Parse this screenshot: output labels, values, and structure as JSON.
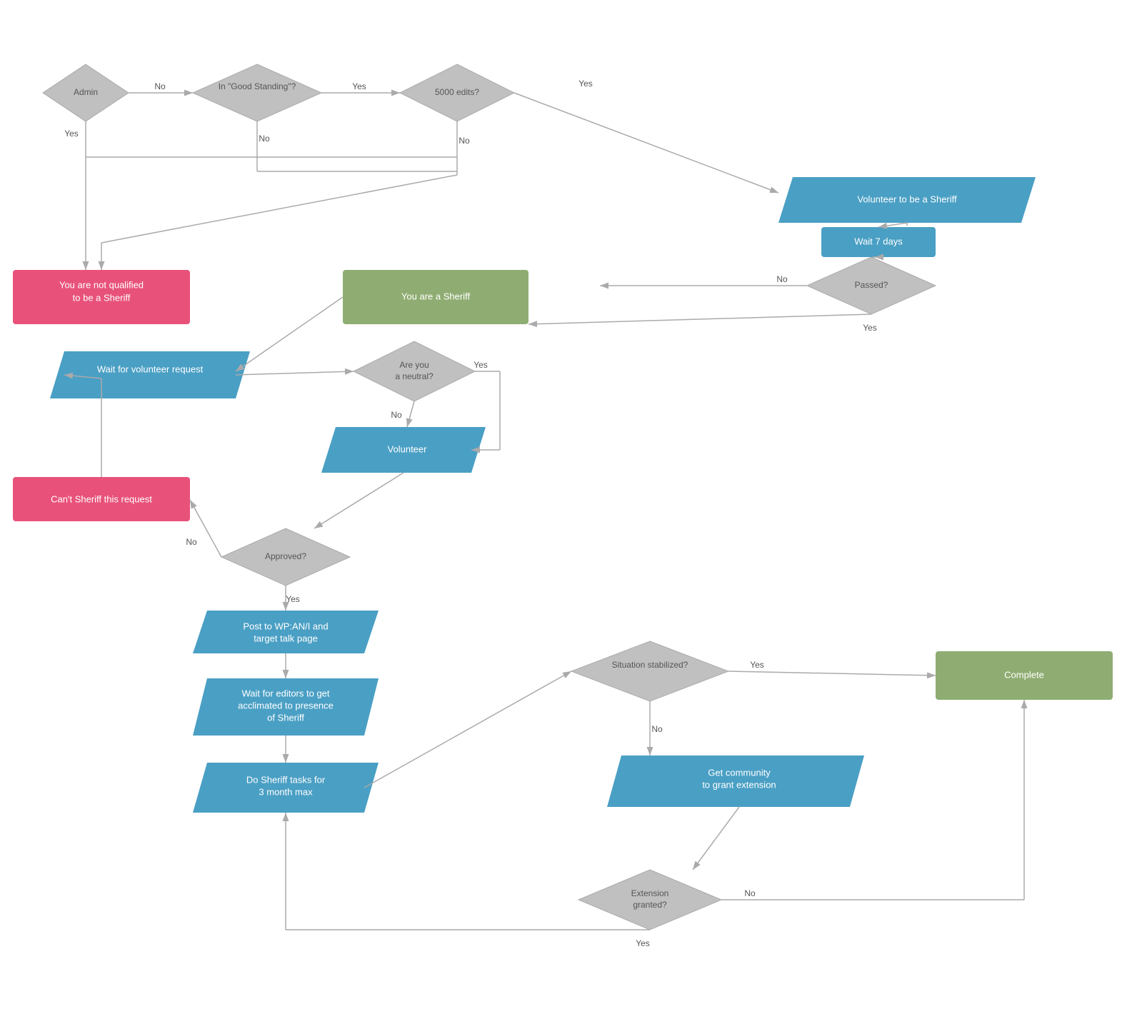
{
  "nodes": {
    "admin": "Admin",
    "good_standing": "In \"Good Standing\"?",
    "edits5000": "5000 edits?",
    "volunteer_sheriff": "Volunteer to be a Sheriff",
    "wait7": "Wait 7 days",
    "passed": "Passed?",
    "not_qualified": "You are not qualified\nto be a Sheriff",
    "you_are_sheriff": "You are a Sheriff",
    "wait_volunteer": "Wait for volunteer request",
    "are_neutral": "Are you\na neutral?",
    "volunteer": "Volunteer",
    "cant_sheriff": "Can't Sheriff this request",
    "approved": "Approved?",
    "post_wp": "Post to WP:AN/I and\ntarget talk page",
    "wait_editors": "Wait for editors to get\nacclimated to presence\nof Sheriff",
    "do_sheriff": "Do Sheriff tasks for\n3 month max",
    "situation_stabilized": "Situation stabilized?",
    "complete": "Complete",
    "get_community": "Get community\nto grant extension",
    "extension_granted": "Extension\ngranted?"
  },
  "labels": {
    "yes": "Yes",
    "no": "No"
  }
}
